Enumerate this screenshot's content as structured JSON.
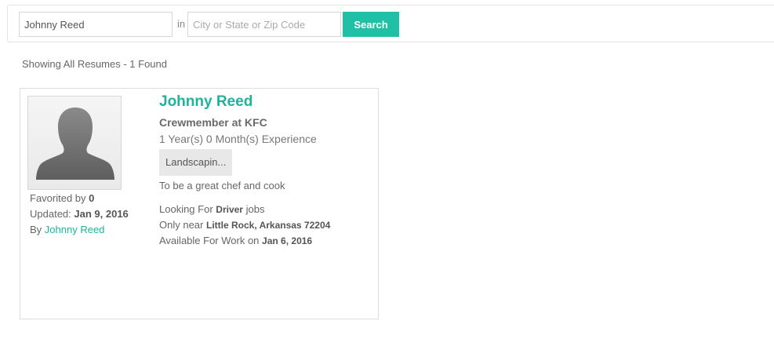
{
  "search": {
    "keyword_value": "Johnny Reed",
    "in_label": "in",
    "location_value": "",
    "location_placeholder": "City or State or Zip Code",
    "button_label": "Search",
    "accent_color": "#1fc0a6"
  },
  "results": {
    "summary_text": "Showing All Resumes - 1 Found"
  },
  "resume": {
    "avatar_icon": "person-silhouette-icon",
    "favorited_label": "Favorited by",
    "favorited_count": "0",
    "updated_label": "Updated:",
    "updated_date": "Jan 9, 2016",
    "by_label": "By",
    "by_name": "Johnny Reed",
    "name": "Johnny Reed",
    "job_title": "Crewmember at KFC",
    "experience": "1 Year(s) 0 Month(s) Experience",
    "skill_tag": "Landscapin...",
    "summary": "To be a great chef and cook",
    "looking_prefix": "Looking For",
    "looking_job": "Driver",
    "looking_suffix": "jobs",
    "near_prefix": "Only near",
    "near_location": "Little Rock, Arkansas 72204",
    "available_prefix": "Available For Work on",
    "available_date": "Jan 6, 2016"
  }
}
